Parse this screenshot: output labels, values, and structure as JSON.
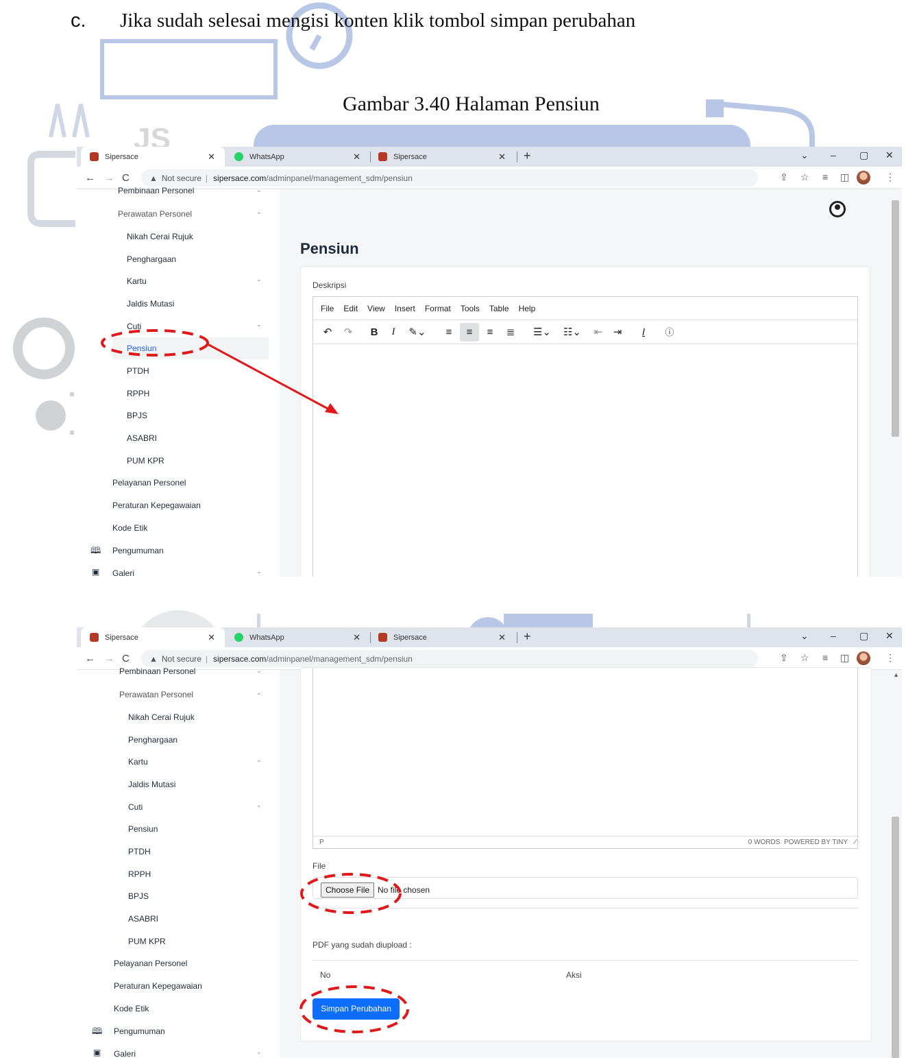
{
  "document": {
    "step_marker": "c.",
    "step_text": "Jika sudah selesai mengisi konten klik tombol simpan perubahan",
    "figure_caption": "Gambar 3.40 Halaman Pensiun"
  },
  "watermark": {
    "text": "JS"
  },
  "browser": {
    "tabs": [
      {
        "title": "Sipersace",
        "icon": "shield-favicon-icon",
        "active": true
      },
      {
        "title": "WhatsApp",
        "icon": "whatsapp-icon",
        "active": false
      },
      {
        "title": "Sipersace",
        "icon": "shield-favicon-icon",
        "active": false
      }
    ],
    "security_label": "Not secure",
    "url_host": "sipersace.com",
    "url_path": "/adminpanel/management_sdm/pensiun"
  },
  "sidebar": {
    "items": [
      {
        "label": "Pembinaan Personel",
        "chevron": true
      },
      {
        "label": "Perawatan Personel",
        "chevron": true
      },
      {
        "label": "Nikah Cerai Rujuk"
      },
      {
        "label": "Penghargaan"
      },
      {
        "label": "Kartu",
        "chevron": true
      },
      {
        "label": "Jaldis Mutasi"
      },
      {
        "label": "Cuti",
        "chevron": true
      },
      {
        "label": "Pensiun",
        "active": true
      },
      {
        "label": "PTDH"
      },
      {
        "label": "RPPH"
      },
      {
        "label": "BPJS"
      },
      {
        "label": "ASABRI"
      },
      {
        "label": "PUM KPR"
      },
      {
        "label": "Pelayanan Personel"
      },
      {
        "label": "Peraturan Kepegawaian"
      },
      {
        "label": "Kode Etik"
      },
      {
        "label": "Pengumuman",
        "icon": "book-icon"
      },
      {
        "label": "Galeri",
        "icon": "image-icon",
        "chevron": true
      }
    ]
  },
  "page": {
    "title": "Pensiun",
    "description_label": "Deskripsi",
    "editor_menu": [
      "File",
      "Edit",
      "View",
      "Insert",
      "Format",
      "Tools",
      "Table",
      "Help"
    ],
    "editor_status_path": "P",
    "editor_status_right": "0 WORDS  POWERED BY TINY",
    "file_label": "File",
    "choose_file_label": "Choose File",
    "no_file_text": "No file chosen",
    "uploaded_label": "PDF yang sudah diupload :",
    "table_headers": [
      "No",
      "Aksi"
    ],
    "save_button": "Simpan Perubahan"
  },
  "colors": {
    "accent": "#0d6efd",
    "annotation": "#e0191b",
    "watermark": "#b9c7e6"
  }
}
